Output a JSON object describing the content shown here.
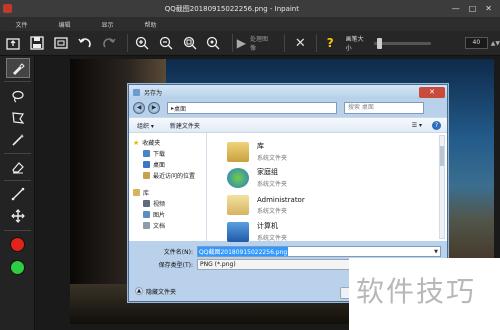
{
  "window": {
    "title": "QQ截图20180915022256.png - Inpaint",
    "controls": [
      "—",
      "□",
      "✕"
    ]
  },
  "menu": [
    "文件",
    "编辑",
    "显示",
    "帮助"
  ],
  "toolbar": {
    "process_label": "处理图像",
    "brush_size_label": "画笔大小",
    "brush_size_value": "40",
    "brush_size_fraction": 0.05
  },
  "tool_colors": {
    "red": "#e0241b",
    "green": "#2ecc40"
  },
  "dialog": {
    "title": "另存为",
    "address": "桌面",
    "search_placeholder": "搜索 桌面",
    "commands": {
      "organize": "组织 ▾",
      "new_folder": "新建文件夹",
      "view": "☰ ▾",
      "help": "?"
    },
    "nav": {
      "favorites": "收藏夹",
      "favorites_items": [
        "下载",
        "桌面",
        "最近访问的位置"
      ],
      "libraries": "库",
      "libraries_items": [
        "视频",
        "图片",
        "文档"
      ]
    },
    "files": [
      {
        "name": "库",
        "desc": "系统文件夹"
      },
      {
        "name": "家庭组",
        "desc": "系统文件夹"
      },
      {
        "name": "Administrator",
        "desc": "系统文件夹"
      },
      {
        "name": "计算机",
        "desc": "系统文件夹"
      }
    ],
    "filename_label": "文件名(N):",
    "filename_value": "QQ截图20180915022256.png",
    "filetype_label": "保存类型(T):",
    "filetype_value": "PNG (*.png)",
    "hide_folders": "隐藏文件夹"
  },
  "watermark": "软件技巧"
}
